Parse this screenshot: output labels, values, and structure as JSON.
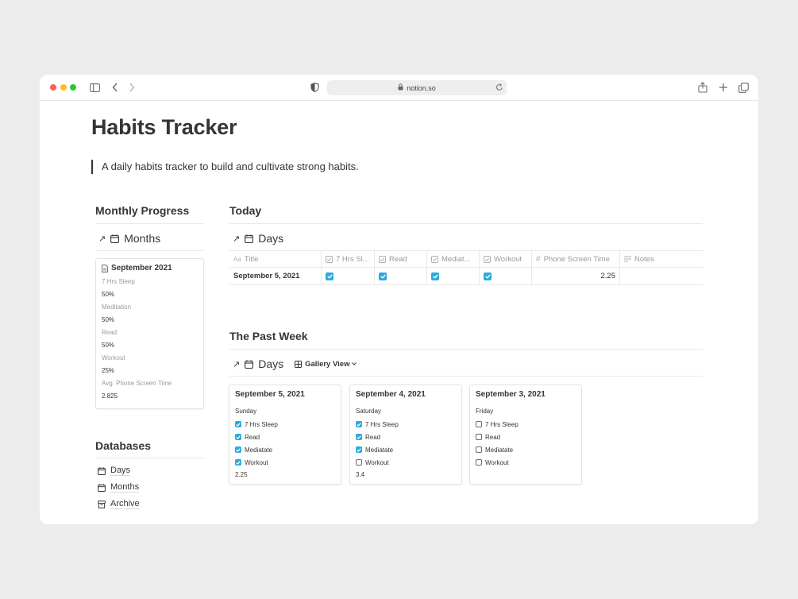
{
  "browser": {
    "url": "notion.so"
  },
  "page": {
    "title": "Habits Tracker",
    "description": "A daily habits tracker to build and cultivate strong habits."
  },
  "monthly": {
    "heading": "Monthly Progress",
    "db_title": "Months",
    "card": {
      "title": "September 2021",
      "fields": [
        {
          "label": "7 Hrs Sleep",
          "value": "50%"
        },
        {
          "label": "Meditation",
          "value": "50%"
        },
        {
          "label": "Read",
          "value": "50%"
        },
        {
          "label": "Workout",
          "value": "25%"
        },
        {
          "label": "Avg. Phone Screen Time",
          "value": "2.825"
        }
      ]
    }
  },
  "today": {
    "heading": "Today",
    "db_title": "Days",
    "columns": [
      "Title",
      "7 Hrs Sl...",
      "Read",
      "Mediat...",
      "Workout",
      "Phone Screen Time",
      "Notes"
    ],
    "row": {
      "title": "September 5, 2021",
      "sleep": true,
      "read": true,
      "meditate": true,
      "workout": true,
      "screen_time": "2.25",
      "notes": ""
    }
  },
  "past_week": {
    "heading": "The Past Week",
    "db_title": "Days",
    "view_label": "Gallery View",
    "cards": [
      {
        "title": "September 5, 2021",
        "day": "Sunday",
        "items": [
          {
            "label": "7 Hrs Sleep",
            "checked": true
          },
          {
            "label": "Read",
            "checked": true
          },
          {
            "label": "Mediatate",
            "checked": true
          },
          {
            "label": "Workout",
            "checked": true
          }
        ],
        "value": "2.25"
      },
      {
        "title": "September 4, 2021",
        "day": "Saturday",
        "items": [
          {
            "label": "7 Hrs Sleep",
            "checked": true
          },
          {
            "label": "Read",
            "checked": true
          },
          {
            "label": "Mediatate",
            "checked": true
          },
          {
            "label": "Workout",
            "checked": false
          }
        ],
        "value": "3.4"
      },
      {
        "title": "September 3, 2021",
        "day": "Friday",
        "items": [
          {
            "label": "7 Hrs Sleep",
            "checked": false
          },
          {
            "label": "Read",
            "checked": false
          },
          {
            "label": "Mediatate",
            "checked": false
          },
          {
            "label": "Workout",
            "checked": false
          }
        ],
        "value": ""
      }
    ]
  },
  "databases": {
    "heading": "Databases",
    "items": [
      {
        "label": "Days",
        "icon": "calendar-icon"
      },
      {
        "label": "Months",
        "icon": "calendar-icon"
      },
      {
        "label": "Archive",
        "icon": "archive-icon"
      }
    ]
  },
  "colors": {
    "checkbox_checked": "#2eaadc",
    "text": "#37352f",
    "muted": "#9b9a97"
  }
}
